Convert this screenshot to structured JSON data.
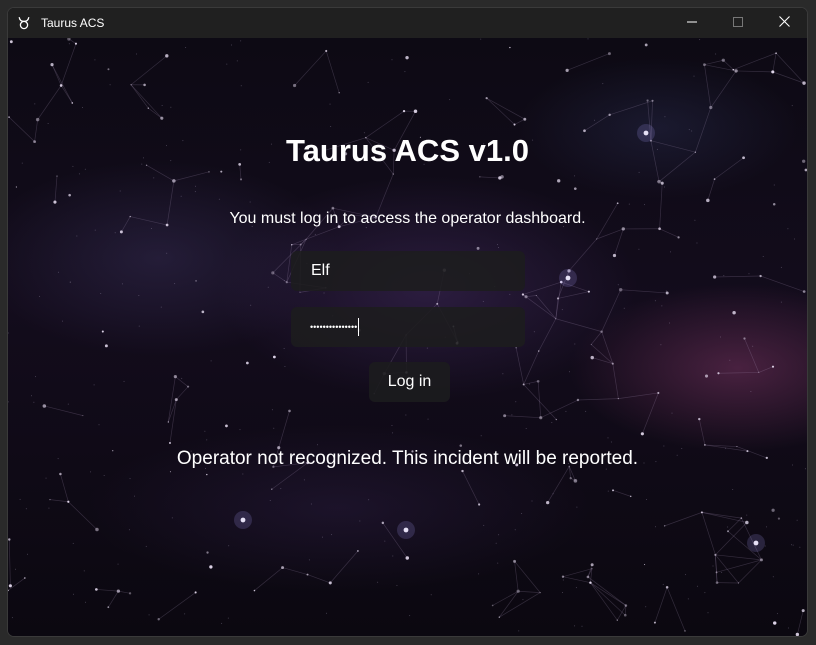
{
  "window": {
    "title": "Taurus ACS",
    "app_icon": "taurus-symbol-icon",
    "controls": [
      "minimize-icon",
      "maximize-icon",
      "close-icon"
    ]
  },
  "login": {
    "heading": "Taurus ACS v1.0",
    "subtitle": "You must log in to access the operator dashboard.",
    "username_value": "Elf",
    "password_masked": "•••••••••••••••",
    "login_button_label": "Log in",
    "status_message": "Operator not recognized. This incident will be reported."
  },
  "colors": {
    "background": "#0d0a14",
    "field_background": "#1c1c1e",
    "text": "#ffffff",
    "titlebar": "#202020"
  }
}
